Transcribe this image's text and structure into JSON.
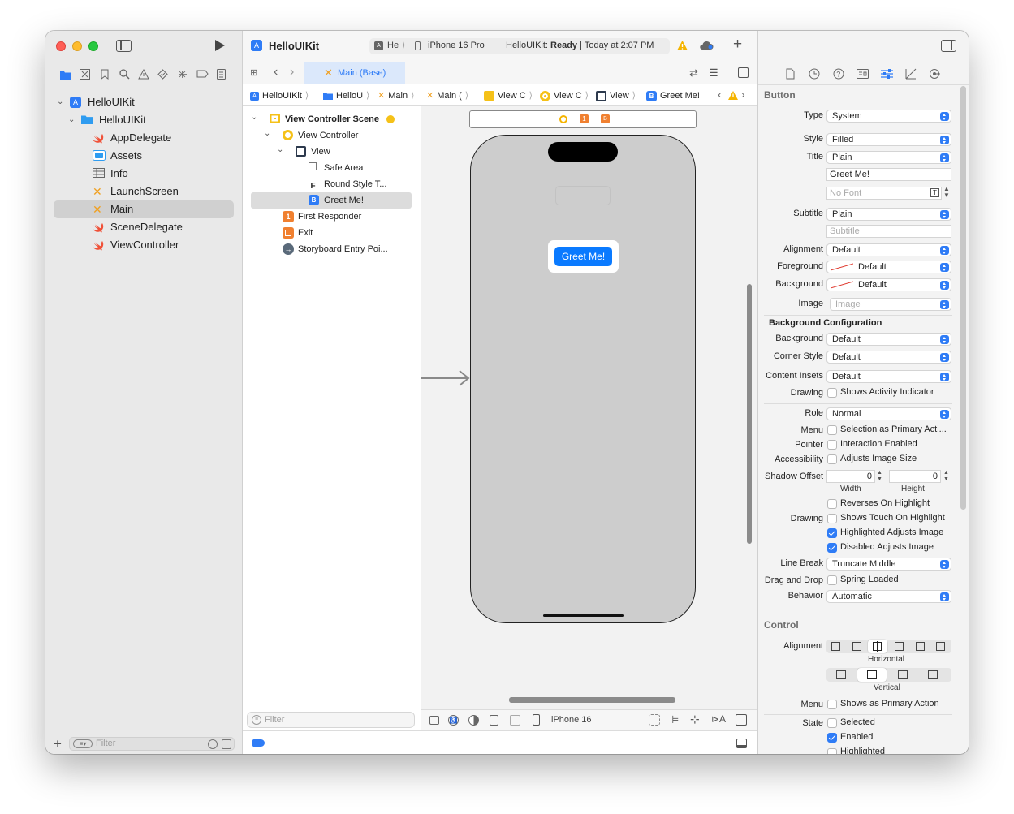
{
  "window": {
    "title": "HelloUIKit"
  },
  "toolbar": {
    "scheme": "He",
    "device": "iPhone 16 Pro",
    "status_prefix": "HelloUIKit: ",
    "status_bold": "Ready",
    "status_suffix": " | Today at 2:07 PM",
    "add_label": "+"
  },
  "navigator": {
    "items": [
      {
        "label": "HelloUIKit",
        "icon": "app-project-icon",
        "depth": 0
      },
      {
        "label": "HelloUIKit",
        "icon": "folder-icon",
        "depth": 1
      },
      {
        "label": "AppDelegate",
        "icon": "swift-file-icon",
        "depth": 2
      },
      {
        "label": "Assets",
        "icon": "asset-catalog-icon",
        "depth": 2
      },
      {
        "label": "Info",
        "icon": "plist-table-icon",
        "depth": 2
      },
      {
        "label": "LaunchScreen",
        "icon": "storyboard-icon",
        "depth": 2
      },
      {
        "label": "Main",
        "icon": "storyboard-icon",
        "depth": 2,
        "selected": true
      },
      {
        "label": "SceneDelegate",
        "icon": "swift-file-icon",
        "depth": 2
      },
      {
        "label": "ViewController",
        "icon": "swift-file-icon",
        "depth": 2
      }
    ],
    "filter_placeholder": "Filter",
    "add_label": "+"
  },
  "editor": {
    "tab_label": "Main (Base)",
    "breadcrumbs": [
      "HelloUIKit",
      "HelloU",
      "Main",
      "Main (",
      "View C",
      "View C",
      "View",
      "Greet Me!"
    ]
  },
  "outline": {
    "items": [
      {
        "label": "View Controller Scene",
        "depth": 0,
        "bold": true
      },
      {
        "label": "View Controller",
        "depth": 1
      },
      {
        "label": "View",
        "depth": 2
      },
      {
        "label": "Safe Area",
        "depth": 3
      },
      {
        "label": "Round Style T...",
        "depth": 3,
        "badge": "F"
      },
      {
        "label": "Greet Me!",
        "depth": 3,
        "badge": "B",
        "selected": true
      },
      {
        "label": "First Responder",
        "depth": 1,
        "badge": "1"
      },
      {
        "label": "Exit",
        "depth": 1
      },
      {
        "label": "Storyboard Entry Poi...",
        "depth": 1
      }
    ],
    "filter_placeholder": "Filter"
  },
  "canvas": {
    "button_label": "Greet Me!",
    "device_label": "iPhone 16",
    "scene_badges": [
      "1",
      "B"
    ]
  },
  "inspector": {
    "section_button": "Button",
    "type": {
      "label": "Type",
      "value": "System"
    },
    "style": {
      "label": "Style",
      "value": "Filled"
    },
    "title": {
      "label": "Title",
      "value": "Plain",
      "text": "Greet Me!",
      "font_placeholder": "No Font"
    },
    "subtitle": {
      "label": "Subtitle",
      "value": "Plain",
      "placeholder": "Subtitle"
    },
    "alignment": {
      "label": "Alignment",
      "value": "Default"
    },
    "foreground": {
      "label": "Foreground",
      "value": "Default"
    },
    "background": {
      "label": "Background",
      "value": "Default"
    },
    "image": {
      "label": "Image",
      "placeholder": "Image"
    },
    "bg_config_header": "Background Configuration",
    "bg_config_background": {
      "label": "Background",
      "value": "Default"
    },
    "corner_style": {
      "label": "Corner Style",
      "value": "Default"
    },
    "content_insets": {
      "label": "Content Insets",
      "value": "Default"
    },
    "drawing1": {
      "label": "Drawing",
      "check": "Shows Activity Indicator"
    },
    "role": {
      "label": "Role",
      "value": "Normal"
    },
    "menu1": {
      "label": "Menu",
      "check": "Selection as Primary Acti..."
    },
    "pointer": {
      "label": "Pointer",
      "check": "Interaction Enabled"
    },
    "accessibility": {
      "label": "Accessibility",
      "check": "Adjusts Image Size"
    },
    "shadow_offset": {
      "label": "Shadow Offset",
      "width": "0",
      "height": "0",
      "width_label": "Width",
      "height_label": "Height"
    },
    "reverses": "Reverses On Highlight",
    "drawing2": {
      "label": "Drawing",
      "check": "Shows Touch On Highlight"
    },
    "highlighted_adjusts": "Highlighted Adjusts Image",
    "disabled_adjusts": "Disabled Adjusts Image",
    "line_break": {
      "label": "Line Break",
      "value": "Truncate Middle"
    },
    "drag_drop": {
      "label": "Drag and Drop",
      "check": "Spring Loaded"
    },
    "behavior": {
      "label": "Behavior",
      "value": "Automatic"
    },
    "section_control": "Control",
    "control_alignment": {
      "label": "Alignment",
      "horizontal": "Horizontal",
      "vertical": "Vertical"
    },
    "menu2": {
      "label": "Menu",
      "check": "Shows as Primary Action"
    },
    "state": {
      "label": "State",
      "selected": "Selected",
      "enabled": "Enabled",
      "highlighted": "Highlighted"
    }
  },
  "colors": {
    "accent": "#2f7cf6",
    "swift": "#f05138",
    "storyboard": "#f0a020",
    "sidebar": "#e8e8e8",
    "canvas": "#f2f2f2",
    "device": "#cdcdcd"
  }
}
